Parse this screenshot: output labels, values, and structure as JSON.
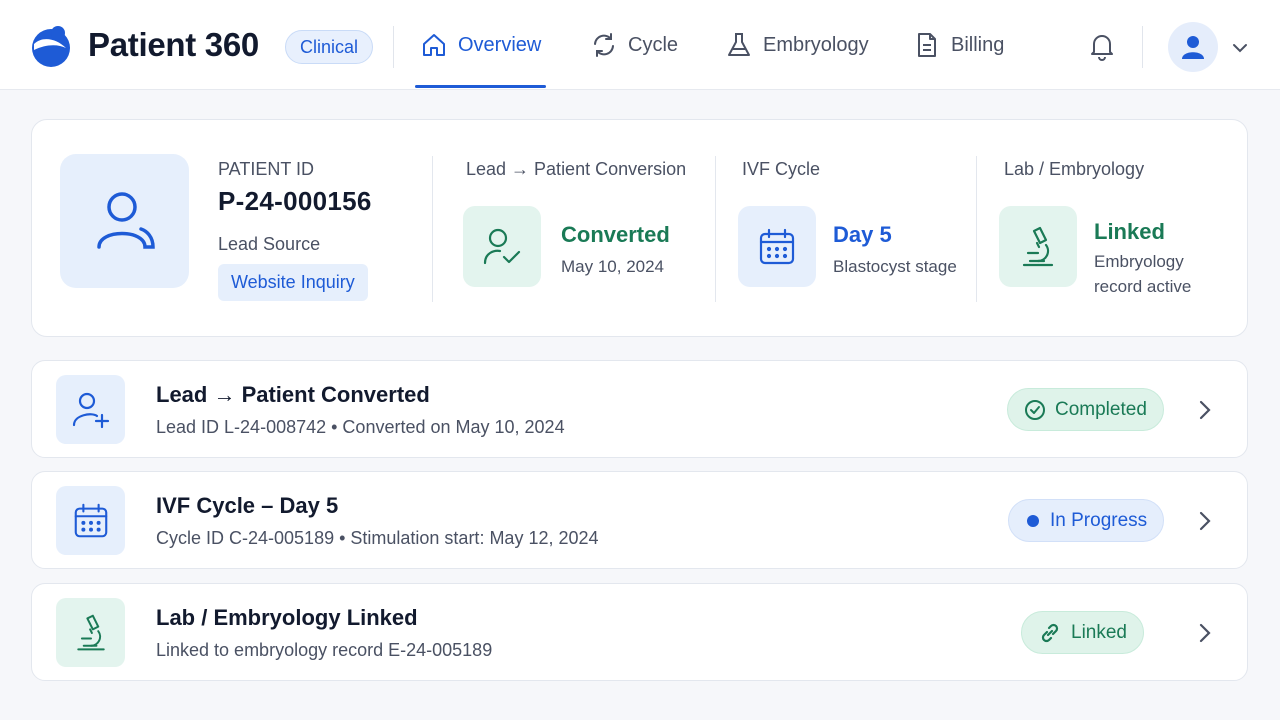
{
  "app": {
    "title": "Patient 360",
    "role_badge": "Clinical"
  },
  "nav": {
    "items": [
      {
        "label": "Overview",
        "icon": "home-icon",
        "active": true
      },
      {
        "label": "Cycle",
        "icon": "refresh-icon",
        "active": false
      },
      {
        "label": "Embryology",
        "icon": "flask-icon",
        "active": false
      },
      {
        "label": "Billing",
        "icon": "document-icon",
        "active": false
      }
    ]
  },
  "header_icons": {
    "notifications": "bell-icon",
    "user": "user-icon",
    "menu": "chevron-down-icon"
  },
  "summary": {
    "patient_id_label": "PATIENT ID",
    "patient_id": "P-24-000156",
    "lead_source_label": "Lead Source",
    "lead_source": "Website Inquiry",
    "conversion": {
      "header": "Lead → Patient Conversion",
      "status": "Converted",
      "date": "May 10, 2024",
      "icon": "user-check-icon"
    },
    "cycle": {
      "header": "IVF Cycle",
      "status": "Day 5",
      "detail": "Blastocyst stage",
      "icon": "calendar-icon"
    },
    "lab": {
      "header": "Lab / Embryology",
      "status": "Linked",
      "detail_line1": "Embryology",
      "detail_line2": "record active",
      "icon": "microscope-icon"
    }
  },
  "timeline": [
    {
      "title": "Lead → Patient Converted",
      "subtitle": "Lead ID L-24-008742  •  Converted on May 10, 2024",
      "status": "Completed",
      "status_icon": "check-circle-icon",
      "icon": "user-plus-icon"
    },
    {
      "title": "IVF Cycle – Day 5",
      "subtitle": "Cycle ID C-24-005189  •  Stimulation start: May 12, 2024",
      "status": "In Progress",
      "status_icon": "dot-icon",
      "icon": "calendar-icon"
    },
    {
      "title": "Lab / Embryology Linked",
      "subtitle": "Linked to embryology record E-24-005189",
      "status": "Linked",
      "status_icon": "link-icon",
      "icon": "microscope-icon"
    }
  ],
  "colors": {
    "accent": "#1e5bd6",
    "success": "#1a7a56",
    "success_bg": "#e3f4ee",
    "info_bg": "#e6effc"
  }
}
